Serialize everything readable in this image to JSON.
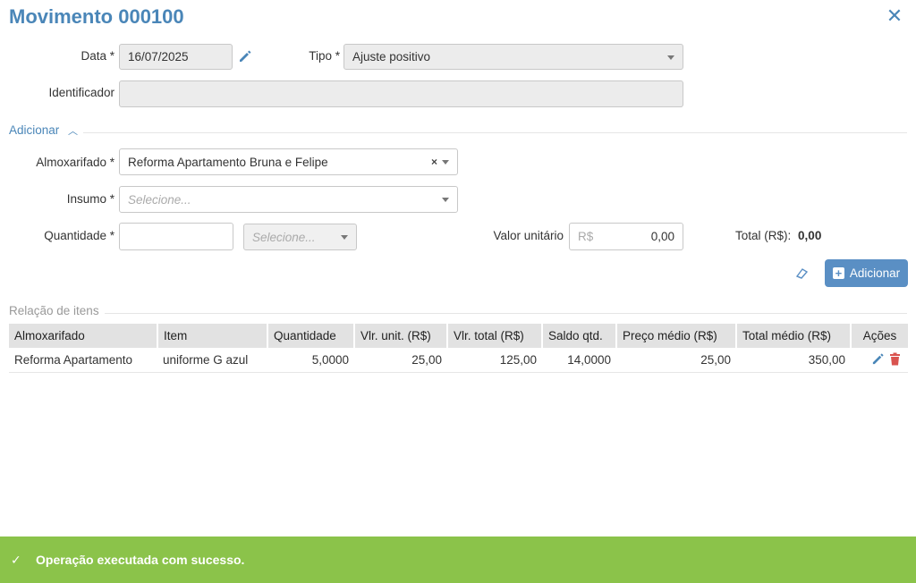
{
  "header": {
    "title": "Movimento 000100"
  },
  "form": {
    "data_label": "Data *",
    "data_value": "16/07/2025",
    "tipo_label": "Tipo *",
    "tipo_value": "Ajuste positivo",
    "identificador_label": "Identificador",
    "identificador_value": ""
  },
  "adicionar": {
    "section_label": "Adicionar",
    "almoxarifado_label": "Almoxarifado *",
    "almoxarifado_value": "Reforma Apartamento Bruna e Felipe",
    "insumo_label": "Insumo *",
    "insumo_placeholder": "Selecione...",
    "quantidade_label": "Quantidade *",
    "quantidade_value": "",
    "unidade_placeholder": "Selecione...",
    "valor_label": "Valor unitário",
    "valor_prefix": "R$",
    "valor_value": "0,00",
    "total_label": "Total (R$):",
    "total_value": "0,00",
    "add_button": "Adicionar"
  },
  "relacao": {
    "section_label": "Relação de itens",
    "columns": [
      "Almoxarifado",
      "Item",
      "Quantidade",
      "Vlr. unit. (R$)",
      "Vlr. total (R$)",
      "Saldo qtd.",
      "Preço médio (R$)",
      "Total médio (R$)",
      "Ações"
    ],
    "rows": [
      [
        "Reforma Apartamento",
        "uniforme G azul",
        "5,0000",
        "25,00",
        "125,00",
        "14,0000",
        "25,00",
        "350,00"
      ]
    ]
  },
  "toast": {
    "message": "Operação executada com sucesso."
  },
  "colors": {
    "accent": "#4a86b8",
    "button": "#5a8fc4",
    "success": "#8bc34a",
    "delete": "#d9534f"
  }
}
